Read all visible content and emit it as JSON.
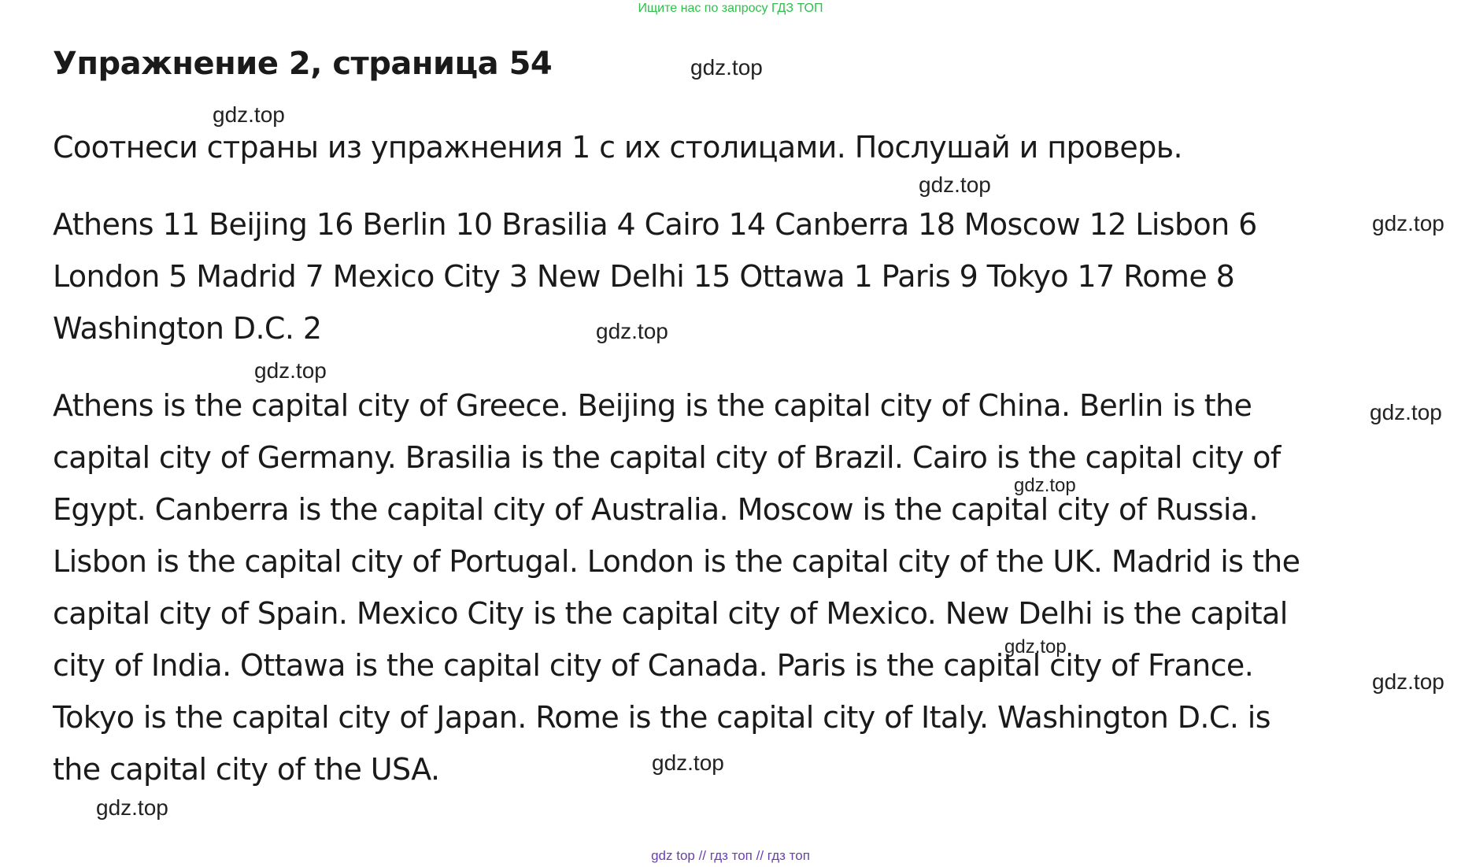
{
  "top_banner": "Ищите нас по запросу ГДЗ ТОП",
  "title": "Упражнение 2, страница 54",
  "instruction": "Соотнеси страны из упражнения 1 с их столицами. Послушай и проверь.",
  "numbers_lines": [
    "Athens 11 Beijing 16 Berlin 10 Brasilia 4 Cairo 14 Canberra 18 Moscow 12 Lisbon 6",
    "London 5 Madrid 7 Mexico City 3 New Delhi 15 Ottawa 1 Paris 9 Tokyo 17 Rome 8",
    "Washington D.C. 2"
  ],
  "answer_lines": [
    "Athens is the capital city of Greece. Beijing is the capital city of China. Berlin is the",
    "capital city of Germany. Brasilia is the capital city of Brazil. Cairo is the capital city of",
    "Egypt. Canberra is the capital city of Australia. Moscow is the capital city of Russia.",
    "Lisbon is the capital city of Portugal. London is the capital city of the UK. Madrid is the",
    "capital city of Spain. Mexico City is the capital city of Mexico. New Delhi is the capital",
    "city of India. Ottawa is the capital city of Canada. Paris is the capital city of France.",
    "Tokyo is the capital city of Japan. Rome is the capital city of Italy. Washington D.C. is",
    "the capital city of the USA."
  ],
  "watermark": "gdz.top",
  "bottom_banner": "gdz top  //  гдз топ  //  гдз топ"
}
